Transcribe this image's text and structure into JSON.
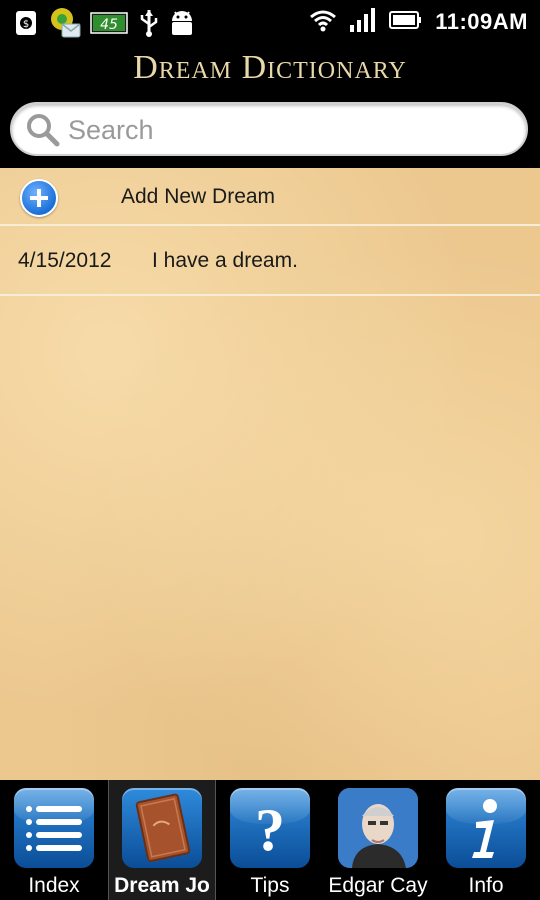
{
  "status_bar": {
    "battery_label": "45",
    "time": "11:09AM"
  },
  "app": {
    "title": "Dream Dictionary"
  },
  "search": {
    "placeholder": "Search",
    "value": ""
  },
  "list": {
    "add_label": "Add New Dream",
    "entries": [
      {
        "date": "4/15/2012",
        "title": "I have a dream."
      }
    ]
  },
  "tabs": [
    {
      "label": "Index",
      "icon": "list-icon",
      "active": false
    },
    {
      "label": "Dream Jo",
      "icon": "journal-icon",
      "active": true
    },
    {
      "label": "Tips",
      "icon": "question-icon",
      "active": false
    },
    {
      "label": "Edgar Cay",
      "icon": "portrait-icon",
      "active": false
    },
    {
      "label": "Info",
      "icon": "info-icon",
      "active": false
    }
  ],
  "colors": {
    "title": "#e8d7a8",
    "parchment": "#ecc88f",
    "tab_blue": "#1f6fc4"
  }
}
